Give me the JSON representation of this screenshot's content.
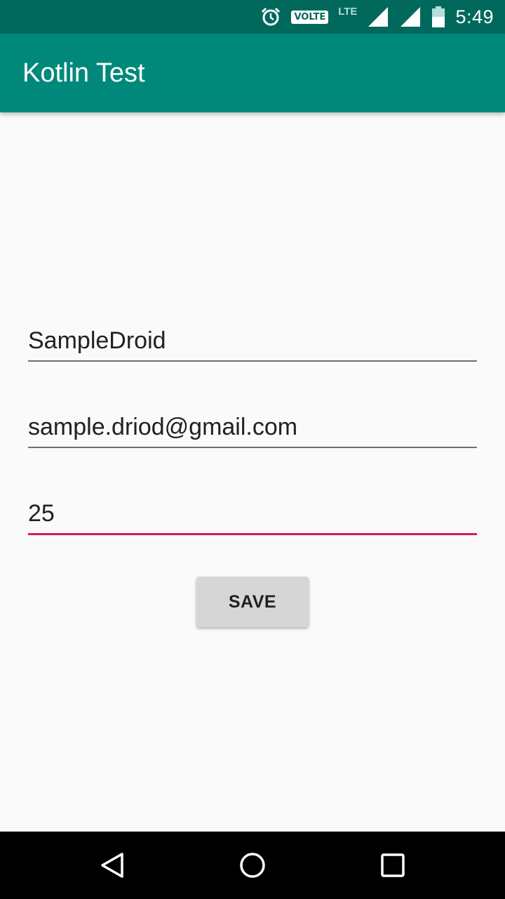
{
  "status_bar": {
    "time": "5:49",
    "volte_label": "VOLTE",
    "lte_label": "LTE",
    "icons": [
      "alarm-icon",
      "volte-icon",
      "lte-icon",
      "signal-icon",
      "signal-icon",
      "battery-icon"
    ]
  },
  "app_bar": {
    "title": "Kotlin Test",
    "color": "#00897b"
  },
  "form": {
    "name_value": "SampleDroid",
    "email_value": "sample.driod@gmail.com",
    "age_value": "25",
    "save_label": "SAVE",
    "accent_color": "#d81b60"
  },
  "nav_bar": {
    "icons": [
      "back-icon",
      "home-icon",
      "recents-icon"
    ]
  }
}
